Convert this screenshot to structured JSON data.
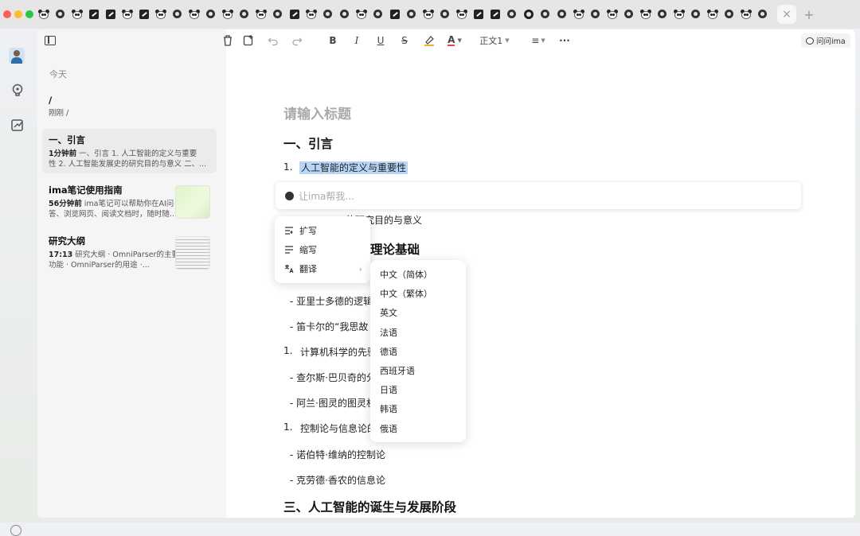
{
  "tabbar": {
    "icons": [
      "panda",
      "pin",
      "panda",
      "edit",
      "edit",
      "panda",
      "edit",
      "panda",
      "pin",
      "panda",
      "pin",
      "panda",
      "pin",
      "panda",
      "pin",
      "edit",
      "panda",
      "pin",
      "pin",
      "panda",
      "pin",
      "edit",
      "pin",
      "panda",
      "pin",
      "panda",
      "edit",
      "edit",
      "pin",
      "gear",
      "pin",
      "pin",
      "panda",
      "pin",
      "panda",
      "pin",
      "panda",
      "pin",
      "panda",
      "pin",
      "panda",
      "pin",
      "panda",
      "pin"
    ],
    "close_symbol": "×",
    "add_symbol": "+"
  },
  "toolbar": {
    "paragraph_style": "正文1",
    "ask_ima": "问问ima",
    "icons": [
      "sidebar-toggle-icon",
      "trash-icon",
      "new-note-icon",
      "undo-icon",
      "redo-icon",
      "bold-icon",
      "italic-icon",
      "underline-icon",
      "strikethrough-icon",
      "highlight-icon",
      "font-color-icon",
      "align-icon",
      "more-icon"
    ]
  },
  "sidebar": {
    "section": "今天",
    "notes": [
      {
        "title": "/",
        "time": "刚刚",
        "preview1": "/",
        "preview2": ""
      },
      {
        "title": "一、引言",
        "time": "1分钟前",
        "preview1": "一、引言    1. 人工智能的定义与重要",
        "preview2": "性    2. 人工智能发展史的研究目的与意义    二、..."
      },
      {
        "title": "ima笔记使用指南",
        "time": "56分钟前",
        "preview1": "ima笔记可以帮助你在AI问",
        "preview2": "答、浏览网页、阅读文档时，随时随..."
      },
      {
        "title": "研究大纲",
        "time": "17:13",
        "preview1": "研究大纲    · OmniParser的主要",
        "preview2": "功能    · OmniParser的用途    ·..."
      }
    ]
  },
  "editor": {
    "title_placeholder": "请输入标题",
    "h1": "一、引言",
    "n1": "1.",
    "item1": "人工智能的定义与重要性",
    "ai_placeholder": "让ima帮我...",
    "item2_tail": "的研究目的与意义",
    "h2_tail": "理论基础",
    "b1": "- 亚里士多德的逻辑",
    "b2": "- 笛卡尔的“我思故",
    "n3": "1.",
    "item3": "计算机科学的先驱",
    "b3": "- 查尔斯·巴贝奇的分",
    "b4": "- 阿兰·图灵的图灵机",
    "n4": "1.",
    "item4": "控制论与信息论的",
    "b5": "- 诺伯特·维纳的控制论",
    "b6": "- 克劳德·香农的信息论",
    "h3": "三、人工智能的诞生与发展阶段"
  },
  "context_menu": {
    "items": [
      {
        "label": "扩写",
        "icon": "expand-icon"
      },
      {
        "label": "缩写",
        "icon": "shorten-icon"
      },
      {
        "label": "翻译",
        "icon": "translate-icon",
        "submenu": true
      }
    ]
  },
  "translate_menu": {
    "items": [
      "中文（简体）",
      "中文（繁体）",
      "英文",
      "法语",
      "德语",
      "西班牙语",
      "日语",
      "韩语",
      "俄语"
    ]
  },
  "colors": {
    "highlight": "#b7d6f7",
    "accent": "#2f6ea8"
  }
}
